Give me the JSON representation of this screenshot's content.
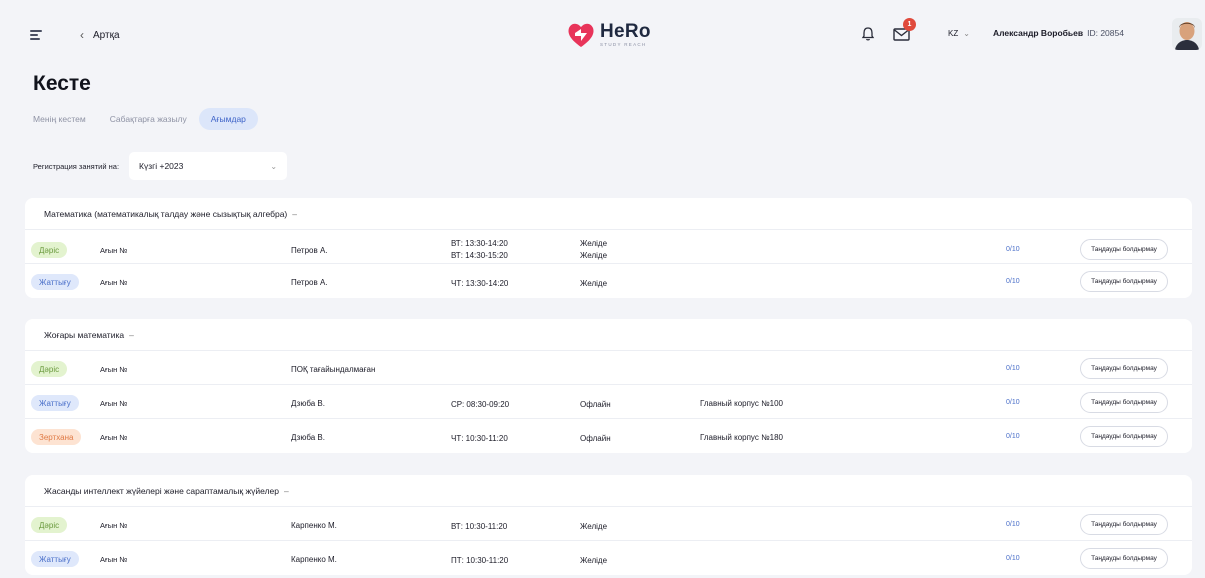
{
  "header": {
    "back_label": "Артқа",
    "logo_name": "HeRo",
    "logo_sub": "STUDY REACH",
    "notifications_badge": "1",
    "language": "KZ",
    "user_name": "Александр Воробьев",
    "user_id": "ID: 20854"
  },
  "page_title": "Кесте",
  "tabs": [
    {
      "label": "Менің кестем",
      "active": false
    },
    {
      "label": "Сабақтарға жазылу",
      "active": false
    },
    {
      "label": "Ағымдар",
      "active": true
    }
  ],
  "registration": {
    "label": "Регистрация занятий на:",
    "value": "Күзгі +2023"
  },
  "colors": {
    "accent": "#3f64c8",
    "lecture_bg": "#e3f3cf",
    "practice_bg": "#dfe8fb",
    "lab_bg": "#fde3d2",
    "badge": "#e04a3c"
  },
  "courses": [
    {
      "title": "Математика (математикалық талдау және сызықтық алгебра)",
      "rows": [
        {
          "type": "Дәріс",
          "group": "Ағын №",
          "teacher": "Петров А.",
          "time1": "ВТ: 13:30-14:20",
          "time2": "ВТ: 14:30-15:20",
          "format1": "Желіде",
          "format2": "Желіде",
          "room": "",
          "count": "0/10",
          "action": "Таңдауды болдырмау"
        },
        {
          "type": "Жаттығу",
          "group": "Ағын №",
          "teacher": "Петров А.",
          "time1": "ЧТ: 13:30-14:20",
          "format1": "Желіде",
          "room": "",
          "count": "0/10",
          "action": "Таңдауды болдырмау"
        }
      ]
    },
    {
      "title": "Жоғары математика",
      "rows": [
        {
          "type": "Дәріс",
          "group": "Ағын №",
          "teacher": "ПОҚ тағайындалмаған",
          "time1": "",
          "format1": "",
          "room": "",
          "count": "0/10",
          "action": "Таңдауды болдырмау"
        },
        {
          "type": "Жаттығу",
          "group": "Ағын №",
          "teacher": "Дзюба В.",
          "time1": "СР: 08:30-09:20",
          "format1": "Офлайн",
          "room": "Главный корпус №100",
          "count": "0/10",
          "action": "Таңдауды болдырмау"
        },
        {
          "type": "Зертхана",
          "group": "Ағын №",
          "teacher": "Дзюба В.",
          "time1": "ЧТ: 10:30-11:20",
          "format1": "Офлайн",
          "room": "Главный корпус №180",
          "count": "0/10",
          "action": "Таңдауды болдырмау"
        }
      ]
    },
    {
      "title": "Жасанды интеллект жүйелері және сараптамалық жүйелер",
      "rows": [
        {
          "type": "Дәріс",
          "group": "Ағын №",
          "teacher": "Карпенко М.",
          "time1": "ВТ: 10:30-11:20",
          "format1": "Желіде",
          "room": "",
          "count": "0/10",
          "action": "Таңдауды болдырмау"
        },
        {
          "type": "Жаттығу",
          "group": "Ағын №",
          "teacher": "Карпенко М.",
          "time1": "ПТ: 10:30-11:20",
          "format1": "Желіде",
          "room": "",
          "count": "0/10",
          "action": "Таңдауды болдырмау"
        }
      ]
    }
  ]
}
